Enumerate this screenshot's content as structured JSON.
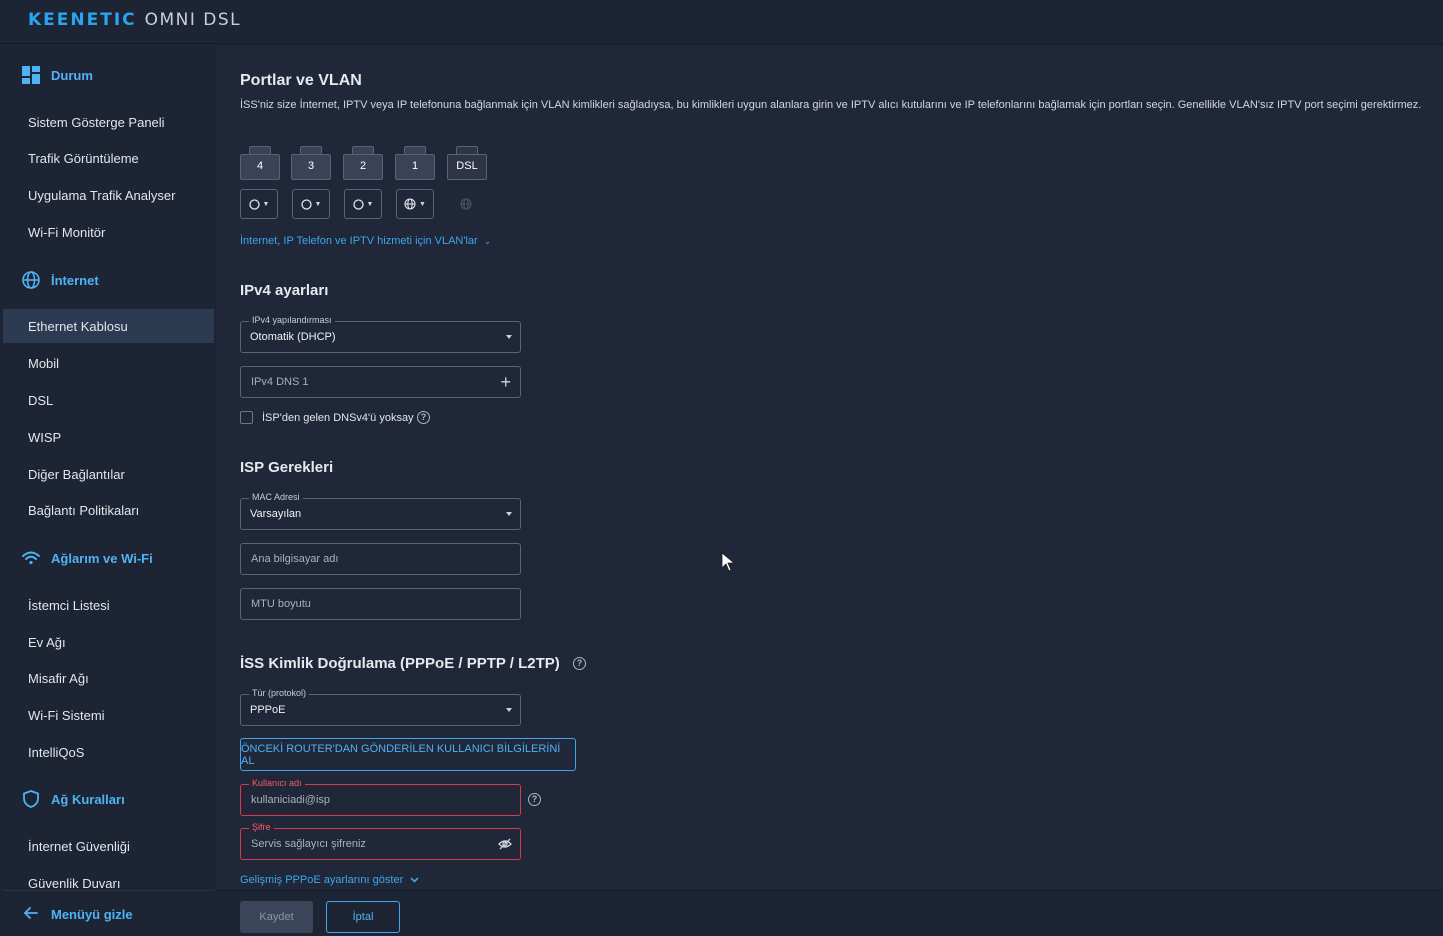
{
  "header": {
    "brand": "KEENETIC",
    "model": "OMNI DSL"
  },
  "sidebar": {
    "sections": [
      {
        "label": "Durum",
        "icon": "dashboard-icon"
      },
      {
        "label": "İnternet",
        "icon": "globe-icon"
      },
      {
        "label": "Ağlarım ve Wi-Fi",
        "icon": "wifi-icon"
      },
      {
        "label": "Ağ Kuralları",
        "icon": "shield-icon"
      }
    ],
    "items": [
      "Sistem Gösterge Paneli",
      "Trafik Görüntüleme",
      "Uygulama Trafik Analyser",
      "Wi-Fi Monitör",
      "Ethernet Kablosu",
      "Mobil",
      "DSL",
      "WISP",
      "Diğer Bağlantılar",
      "Bağlantı Politikaları",
      "İstemci Listesi",
      "Ev Ağı",
      "Misafir Ağı",
      "Wi-Fi Sistemi",
      "IntelliQoS",
      "İnternet Güvenliği",
      "Güvenlik Duvarı"
    ],
    "active_item": "Ethernet Kablosu",
    "hide_menu_label": "Menüyü gizle"
  },
  "ports": {
    "title": "Portlar ve VLAN",
    "description": "İSS'niz size İnternet, IPTV veya IP telefonuna bağlanmak için VLAN kimlikleri sağladıysa, bu kimlikleri uygun alanlara girin ve IPTV alıcı kutularını ve IP telefonlarını bağlamak için portları seçin. Genellikle VLAN'sız IPTV port seçimi gerektirmez.",
    "port_labels": [
      "4",
      "3",
      "2",
      "1",
      "DSL"
    ],
    "vlan_link": "İnternet, IP Telefon ve IPTV hizmeti için VLAN'lar"
  },
  "ipv4": {
    "title": "IPv4 ayarları",
    "config_legend": "IPv4 yapılandırması",
    "config_value": "Otomatik (DHCP)",
    "dns_placeholder": "IPv4 DNS 1",
    "ignore_dns_label": "İSP'den gelen DNSv4'ü yoksay"
  },
  "isp": {
    "title": "ISP Gerekleri",
    "mac_legend": "MAC Adresi",
    "mac_value": "Varsayılan",
    "hostname_placeholder": "Ana bilgisayar adı",
    "mtu_placeholder": "MTU boyutu"
  },
  "auth": {
    "title": "İSS Kimlik Doğrulama (PPPoE / PPTP / L2TP)",
    "type_legend": "Tür (protokol)",
    "type_value": "PPPoE",
    "prev_router_button": "ÖNCEKİ ROUTER'DAN GÖNDERİLEN KULLANICI BİLGİLERİNİ AL",
    "username_legend": "Kullanıcı adı",
    "username_placeholder": "kullaniciadi@isp",
    "password_legend": "Şifre",
    "password_placeholder": "Servis sağlayıcı şifreniz",
    "advanced_link": "Gelişmiş PPPoE ayarlarını göster"
  },
  "actions": {
    "save": "Kaydet",
    "cancel": "İptal"
  },
  "colors": {
    "accent": "#3ea6ee",
    "error": "#d9394a",
    "active_bg": "#2c3a52"
  }
}
